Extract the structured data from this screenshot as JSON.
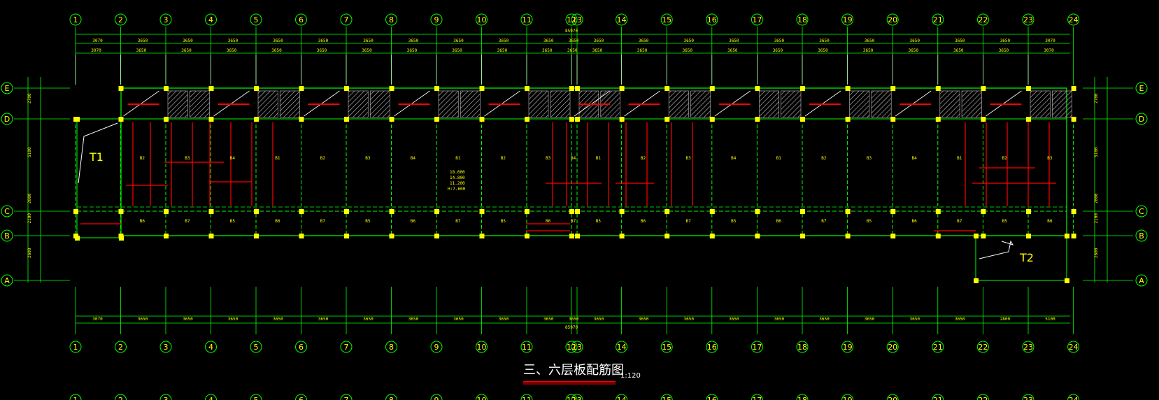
{
  "drawing": {
    "title": "三、六层板配筋图",
    "scale": "1:120",
    "total_dim_top": "85970",
    "total_dim_bottom": "85970",
    "stair_left": "T1",
    "stair_right": "T2",
    "elevation_note": [
      "18.600",
      "14.800",
      "11.200",
      "H:7.600"
    ]
  },
  "axes": {
    "columns": [
      "1",
      "2",
      "3",
      "4",
      "5",
      "6",
      "7",
      "8",
      "9",
      "10",
      "11",
      "12",
      "13",
      "14",
      "15",
      "16",
      "17",
      "18",
      "19",
      "20",
      "21",
      "22",
      "23",
      "24"
    ],
    "rows": [
      "E",
      "D",
      "C",
      "B",
      "A"
    ]
  },
  "dimensions": {
    "top_spans": [
      "3070",
      "3650",
      "3650",
      "3650",
      "3650",
      "3650",
      "3650",
      "3650",
      "3650",
      "3650",
      "3650",
      "3650",
      "3650",
      "3650",
      "3650",
      "3650",
      "3650",
      "3650",
      "3650",
      "3650",
      "3650",
      "3650",
      "3070"
    ],
    "bottom_spans": [
      "3070",
      "3650",
      "3650",
      "3650",
      "3650",
      "3650",
      "3650",
      "3650",
      "3650",
      "3650",
      "3650",
      "3650",
      "3650",
      "3650",
      "3650",
      "3650",
      "3650",
      "3650",
      "3650",
      "3650",
      "3650",
      "2800",
      "5100"
    ],
    "side_left": [
      "2700",
      "5100",
      "2000",
      "2100",
      "2600"
    ],
    "side_right": [
      "2700",
      "5100",
      "2000",
      "2100",
      "2600"
    ]
  },
  "colors": {
    "background": "#000000",
    "grid": "#00ff00",
    "column": "#ffff00",
    "rebar": "#ff0000",
    "text": "#ffff00",
    "bubble": "#00ff00",
    "hatch": "#c0c0c0",
    "title": "#ffffff",
    "underline": "#ff0000"
  }
}
